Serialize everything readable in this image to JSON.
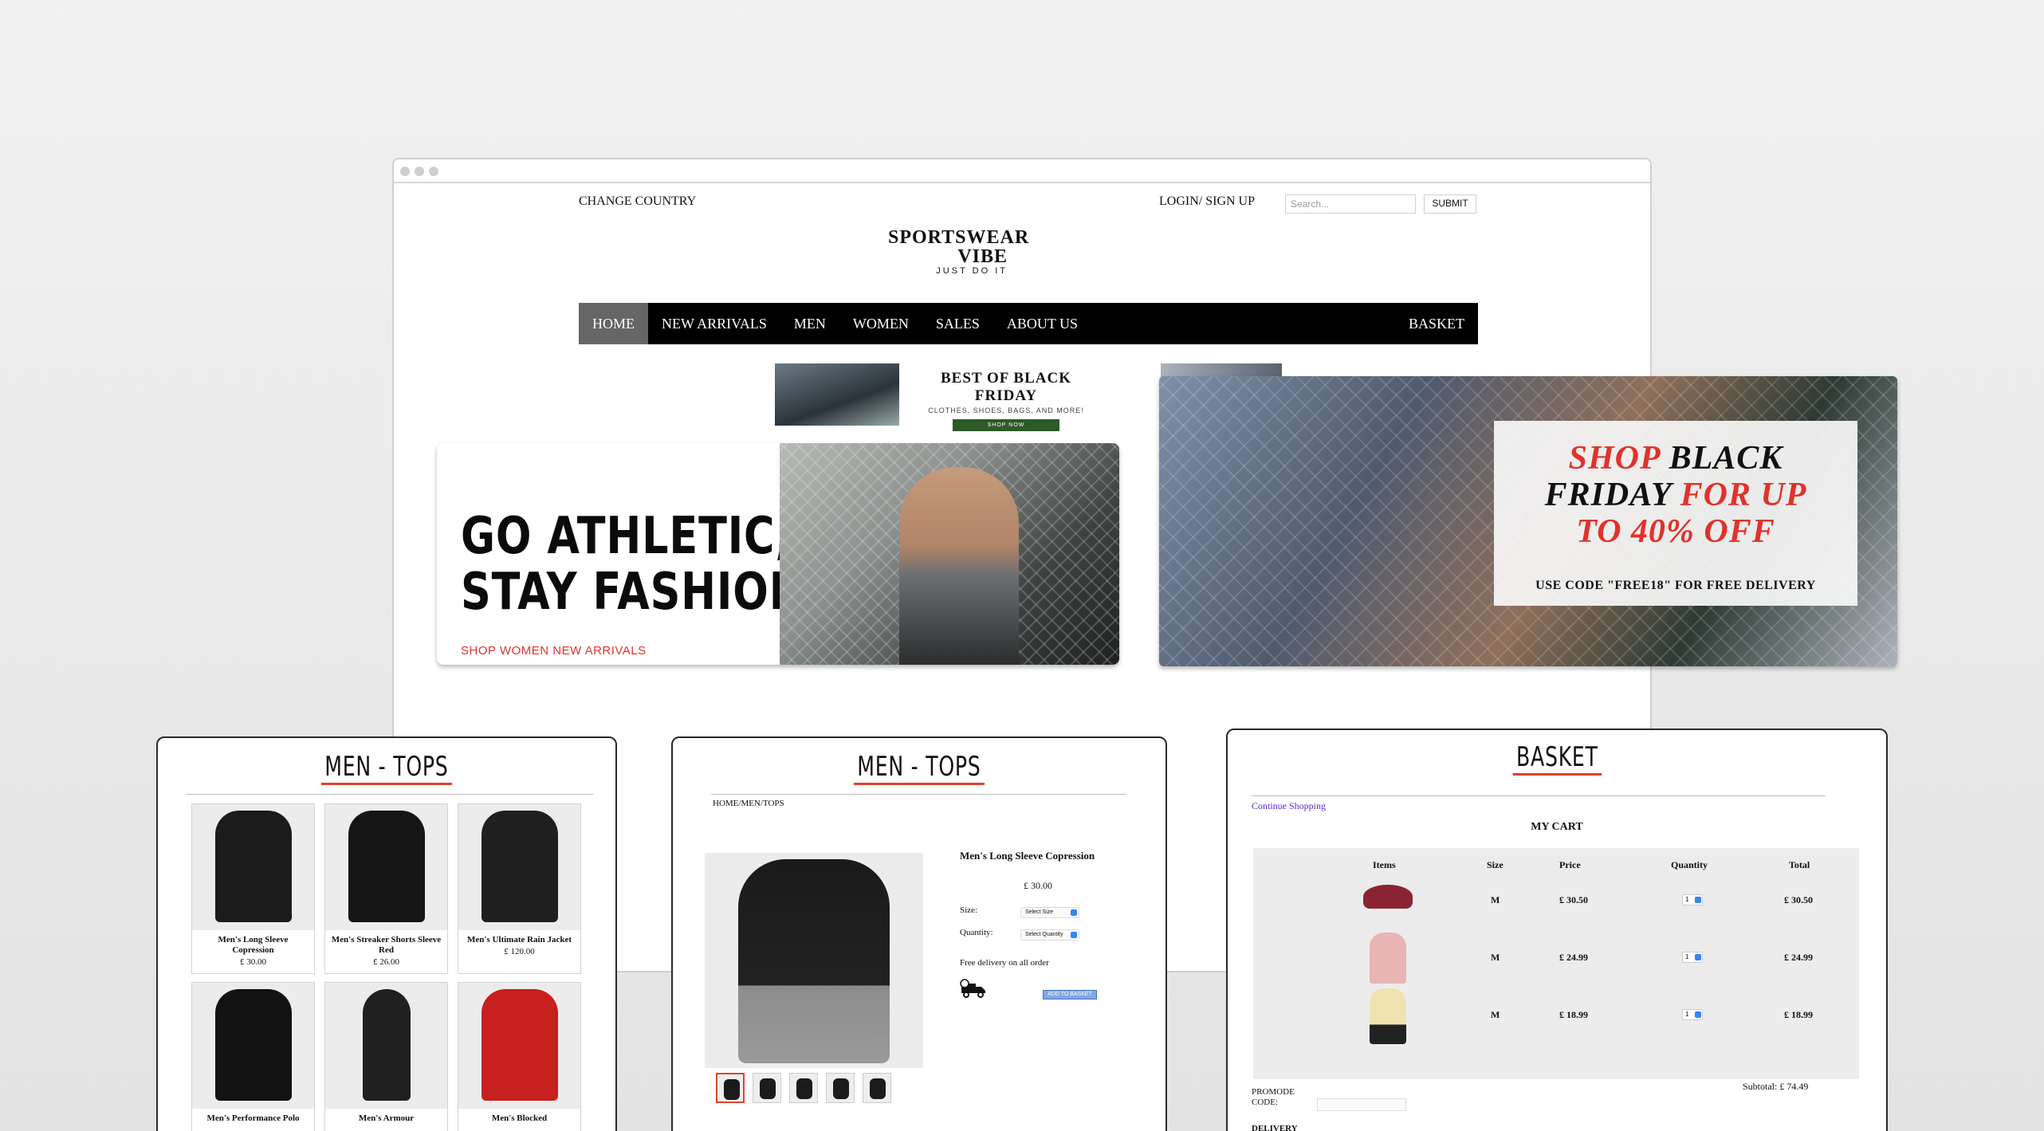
{
  "header": {
    "change_country": "CHANGE COUNTRY",
    "login": "LOGIN/ SIGN UP",
    "search_placeholder": "Search...",
    "submit": "SUBMIT"
  },
  "logo": {
    "line1": "SPORTSWEAR",
    "line2": "VIBE",
    "tagline": "JUST DO IT"
  },
  "nav": {
    "items": [
      "HOME",
      "NEW ARRIVALS",
      "MEN",
      "WOMEN",
      "SALES",
      "ABOUT US"
    ],
    "basket": "BASKET"
  },
  "small_banner": {
    "title": "BEST OF BLACK FRIDAY",
    "subtitle": "CLOTHES, SHOES, BAGS, AND MORE!",
    "button": "SHOP NOW",
    "button_color": "#2d5a27"
  },
  "athletic_banner": {
    "line1": "GO ATHLETIC,",
    "line2": "STAY FASHION",
    "link": "SHOP WOMEN NEW ARRIVALS"
  },
  "black_friday": {
    "w1": "SHOP",
    "w2": "BLACK",
    "w3": "FRIDAY",
    "w4": "FOR UP",
    "w5": "TO 40% OFF",
    "code": "USE CODE \"FREE18\" FOR FREE DELIVERY",
    "accent": "#e0322b"
  },
  "listing": {
    "title": "MEN - TOPS",
    "products": [
      {
        "name": "Men's Long Sleeve Copression",
        "price": "£ 30.00",
        "color": "#1b1b1b"
      },
      {
        "name": "Men's Streaker Shorts Sleeve Red",
        "price": "£ 26.00",
        "color": "#151515"
      },
      {
        "name": "Men's Ultimate Rain Jacket",
        "price": "£ 120.00",
        "color": "#1e1f1e"
      },
      {
        "name": "Men's Performance Polo",
        "price": "",
        "color": "#121212"
      },
      {
        "name": "Men's Armour",
        "price": "",
        "color": "#202020"
      },
      {
        "name": "Men's Blocked",
        "price": "",
        "color": "#c81f1f"
      }
    ]
  },
  "product": {
    "title": "MEN - TOPS",
    "breadcrumb": "HOME/MEN/TOPS",
    "name": "Men's Long Sleeve Copression",
    "price": "£ 30.00",
    "size_label": "Size:",
    "size_select": "Select Size",
    "quantity_label": "Quantity:",
    "quantity_select": "Select Quantity",
    "delivery": "Free delivery on all order",
    "add": "ADD TO BASKET"
  },
  "basket": {
    "title": "BASKET",
    "continue": "Continue Shopping",
    "my_cart": "MY CART",
    "headers": [
      "Items",
      "Size",
      "Price",
      "Quantity",
      "Total"
    ],
    "rows": [
      {
        "size": "M",
        "price": "£ 30.50",
        "qty": "1",
        "total": "£ 30.50",
        "item_color": "#8a2433"
      },
      {
        "size": "M",
        "price": "£ 24.99",
        "qty": "1",
        "total": "£ 24.99",
        "item_color": "#e8b4b4"
      },
      {
        "size": "M",
        "price": "£ 18.99",
        "qty": "1",
        "total": "£ 18.99",
        "item_color": "#efe3b0"
      }
    ],
    "subtotal": "Subtotal: £ 74.49",
    "promo_line1": "PROMODE",
    "promo_line2": "CODE:",
    "delivery": "DELIVERY"
  }
}
